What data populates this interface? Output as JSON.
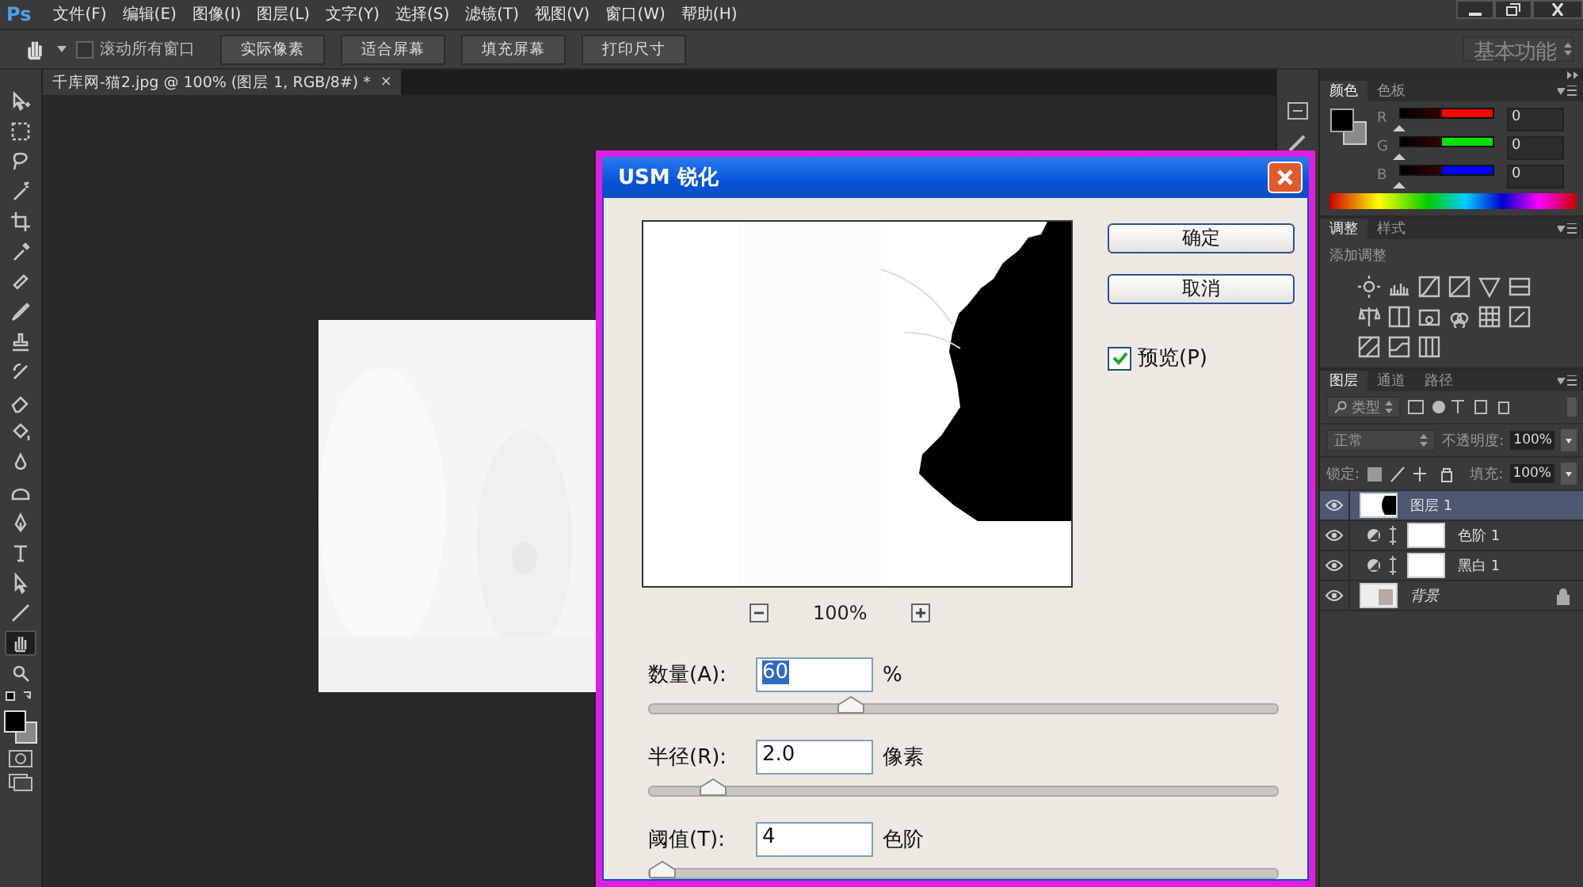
{
  "menu_bar": {
    "logo": "Ps",
    "items": [
      "文件(F)",
      "编辑(E)",
      "图像(I)",
      "图层(L)",
      "文字(Y)",
      "选择(S)",
      "滤镜(T)",
      "视图(V)",
      "窗口(W)",
      "帮助(H)"
    ]
  },
  "options_bar": {
    "scroll_all": {
      "label": "滚动所有窗口",
      "checked": false
    },
    "buttons": [
      "实际像素",
      "适合屏幕",
      "填充屏幕",
      "打印尺寸"
    ],
    "workspace": "基本功能"
  },
  "document_tab": {
    "title": "千库网-猫2.jpg @ 100% (图层 1, RGB/8#) *",
    "close": "×"
  },
  "tools": [
    {
      "selected": false
    },
    {
      "selected": false
    },
    {
      "selected": false
    },
    {
      "selected": false
    },
    {
      "selected": false
    },
    {
      "selected": false
    },
    {
      "selected": false
    },
    {
      "selected": false
    },
    {
      "selected": false
    },
    {
      "selected": false
    },
    {
      "selected": false
    },
    {
      "selected": false
    },
    {
      "selected": false
    },
    {
      "selected": false
    },
    {
      "selected": false
    },
    {
      "selected": false
    },
    {
      "selected": false
    },
    {
      "selected": false
    },
    {
      "selected": true
    },
    {
      "selected": false
    }
  ],
  "color_panel": {
    "tabs": [
      {
        "label": "颜色",
        "selected": true
      },
      {
        "label": "色板",
        "selected": false
      }
    ],
    "channels": [
      {
        "name": "R",
        "value": "0",
        "level": 0,
        "color": "#ff0000"
      },
      {
        "name": "G",
        "value": "0",
        "level": 0,
        "color": "#00e000"
      },
      {
        "name": "B",
        "value": "0",
        "level": 0,
        "color": "#0000ff"
      }
    ]
  },
  "adjustments_panel": {
    "tabs": [
      {
        "label": "调整",
        "selected": true
      },
      {
        "label": "样式",
        "selected": false
      }
    ],
    "hint": "添加调整"
  },
  "layers_panel": {
    "tabs": [
      {
        "label": "图层",
        "selected": true
      },
      {
        "label": "通道",
        "selected": false
      },
      {
        "label": "路径",
        "selected": false
      }
    ],
    "filter": "类型",
    "blend_mode": "正常",
    "opacity_label": "不透明度:",
    "opacity": "100%",
    "lock_label": "锁定:",
    "fill_label": "填充:",
    "fill": "100%",
    "layers": [
      {
        "name": "图层 1",
        "kind": "pixel",
        "selected": true,
        "visible": true,
        "locked": false
      },
      {
        "name": "色阶 1",
        "kind": "adjustment",
        "selected": false,
        "visible": true,
        "locked": false
      },
      {
        "name": "黑白 1",
        "kind": "adjustment",
        "selected": false,
        "visible": true,
        "locked": false
      },
      {
        "name": "背景",
        "kind": "background",
        "selected": false,
        "visible": true,
        "locked": true
      }
    ]
  },
  "dialog": {
    "title": "USM 锐化",
    "buttons": [
      "确定",
      "取消"
    ],
    "preview": {
      "label": "预览(P)",
      "checked": true
    },
    "zoom": "100%",
    "fields": [
      {
        "label": "数量(A):",
        "value": "60",
        "unit": "%",
        "level": 0.32,
        "text_selected": true
      },
      {
        "label": "半径(R):",
        "value": "2.0",
        "unit": "像素",
        "level": 0.1,
        "text_selected": false
      },
      {
        "label": "阈值(T):",
        "value": "4",
        "unit": "色阶",
        "level": 0.02,
        "text_selected": false
      }
    ]
  }
}
